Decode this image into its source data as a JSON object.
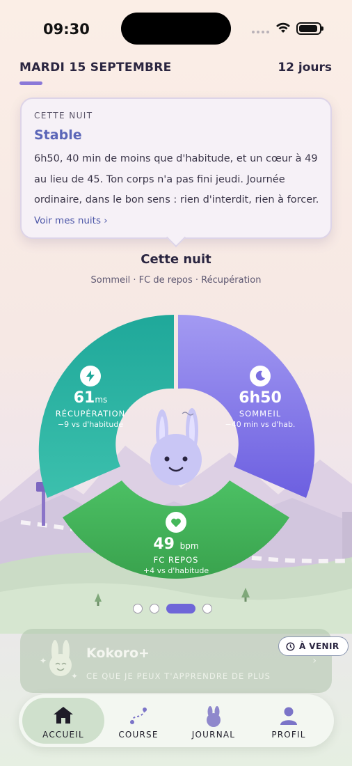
{
  "status_bar": {
    "time": "09:30"
  },
  "header": {
    "date": "MARDI 15 SEPTEMBRE",
    "streak": "12 jours"
  },
  "night_card": {
    "eyebrow": "CETTE NUIT",
    "title": "Stable",
    "body": "6h50, 40 min de moins que d'habitude, et un cœur à 49 au lieu de 45. Ton corps n'a pas fini jeudi. Journée ordinaire, dans le bon sens : rien d'interdit, rien à forcer.",
    "link": "Voir mes nuits ›"
  },
  "section": {
    "title": "Cette nuit",
    "subtitle": "Sommeil · FC de repos · Récupération"
  },
  "metrics": {
    "recovery": {
      "value": "61",
      "unit": "ms",
      "label": "RÉCUPÉRATION",
      "delta": "−9 vs d'habitude",
      "color": "#1fa89a",
      "icon": "lightning-icon"
    },
    "sleep": {
      "value": "6h50",
      "label": "SOMMEIL",
      "delta": "−40 min vs d'hab.",
      "color": "#7a6fe0",
      "icon": "moon-icon"
    },
    "resting_hr": {
      "value": "49",
      "unit": "bpm",
      "label": "FC REPOS",
      "delta": "+4 vs d'habitude",
      "color": "#45b85a",
      "icon": "heart-icon"
    }
  },
  "pager": {
    "pages": 4,
    "active_index": 2
  },
  "promo": {
    "title": "Kokoro+",
    "subtitle": "CE QUE JE PEUX T'APPRENDRE DE PLUS",
    "chevron": "›",
    "badge": "À VENIR"
  },
  "tabs": [
    {
      "label": "ACCUEIL",
      "icon": "home-icon",
      "active": true
    },
    {
      "label": "COURSE",
      "icon": "route-icon",
      "active": false
    },
    {
      "label": "JOURNAL",
      "icon": "bunny-icon",
      "active": false
    },
    {
      "label": "PROFIL",
      "icon": "profile-icon",
      "active": false
    }
  ]
}
